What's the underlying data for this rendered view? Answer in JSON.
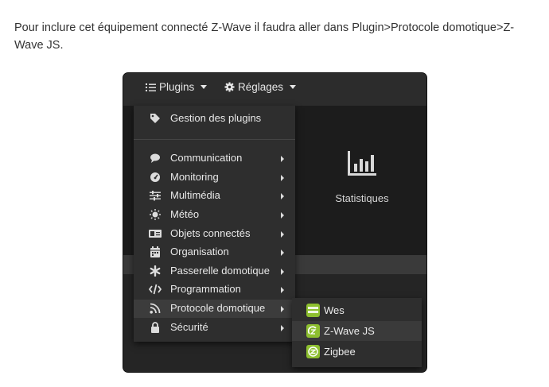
{
  "intro_text": "Pour inclure cet équipement connecté Z-Wave il faudra aller dans Plugin>Protocole domotique>Z-Wave JS.",
  "navbar": {
    "plugins_label": "Plugins",
    "settings_label": "Réglages"
  },
  "dashboard": {
    "stat_label": "Statistiques"
  },
  "plugins_menu": {
    "manage_label": "Gestion des plugins",
    "items": [
      {
        "label": "Communication",
        "icon": "comment-icon"
      },
      {
        "label": "Monitoring",
        "icon": "gauge-icon"
      },
      {
        "label": "Multimédia",
        "icon": "sliders-icon"
      },
      {
        "label": "Météo",
        "icon": "sun-icon"
      },
      {
        "label": "Objets connectés",
        "icon": "id-card-icon"
      },
      {
        "label": "Organisation",
        "icon": "calendar-icon"
      },
      {
        "label": "Passerelle domotique",
        "icon": "asterisk-icon"
      },
      {
        "label": "Programmation",
        "icon": "code-icon"
      },
      {
        "label": "Protocole domotique",
        "icon": "rss-icon"
      },
      {
        "label": "Sécurité",
        "icon": "lock-icon"
      }
    ],
    "active_item": "Protocole domotique"
  },
  "submenu": {
    "items": [
      {
        "label": "Wes",
        "icon": "wes-plugin-icon"
      },
      {
        "label": "Z-Wave JS",
        "icon": "zwave-plugin-icon"
      },
      {
        "label": "Zigbee",
        "icon": "zigbee-plugin-icon"
      }
    ],
    "active_item": "Z-Wave JS"
  },
  "colors": {
    "plugin_green": "#8dbf2f",
    "menu_bg": "#2e2e2e",
    "text": "#e8e8e8"
  }
}
